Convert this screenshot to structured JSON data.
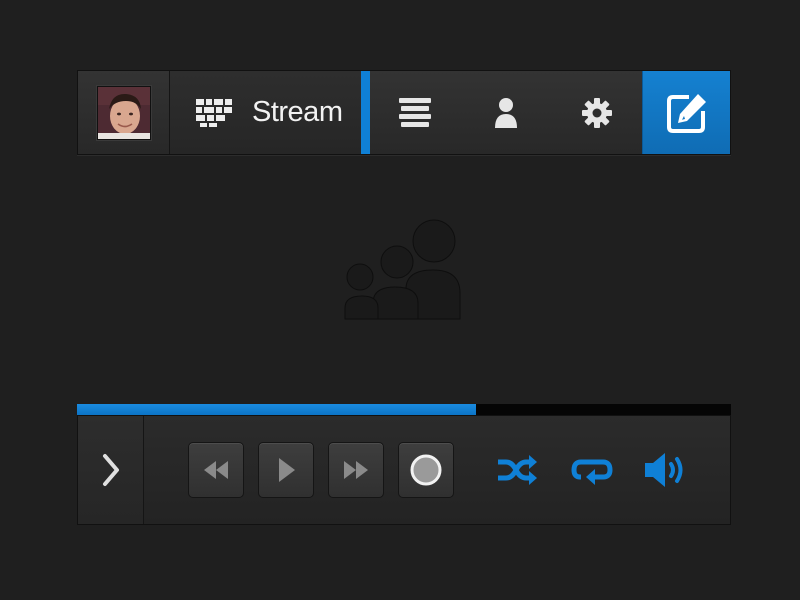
{
  "navbar": {
    "avatar_icon": "user-avatar",
    "stream_icon": "stream-grid-icon",
    "stream_label": "Stream",
    "icons": [
      "list-icon",
      "profile-icon",
      "gear-icon"
    ],
    "compose_icon": "compose-icon",
    "active_color": "#0f80d6"
  },
  "empty_state": {
    "icon": "people-group-icon"
  },
  "player": {
    "progress": 0.61,
    "progress_color": "#0f80d6",
    "expand_icon": "chevron-right-icon",
    "controls": [
      "rewind-icon",
      "play-icon",
      "fast-forward-icon",
      "record-icon"
    ],
    "modes": [
      "shuffle-icon",
      "repeat-icon",
      "volume-icon"
    ],
    "accent_color": "#0f80d6"
  }
}
